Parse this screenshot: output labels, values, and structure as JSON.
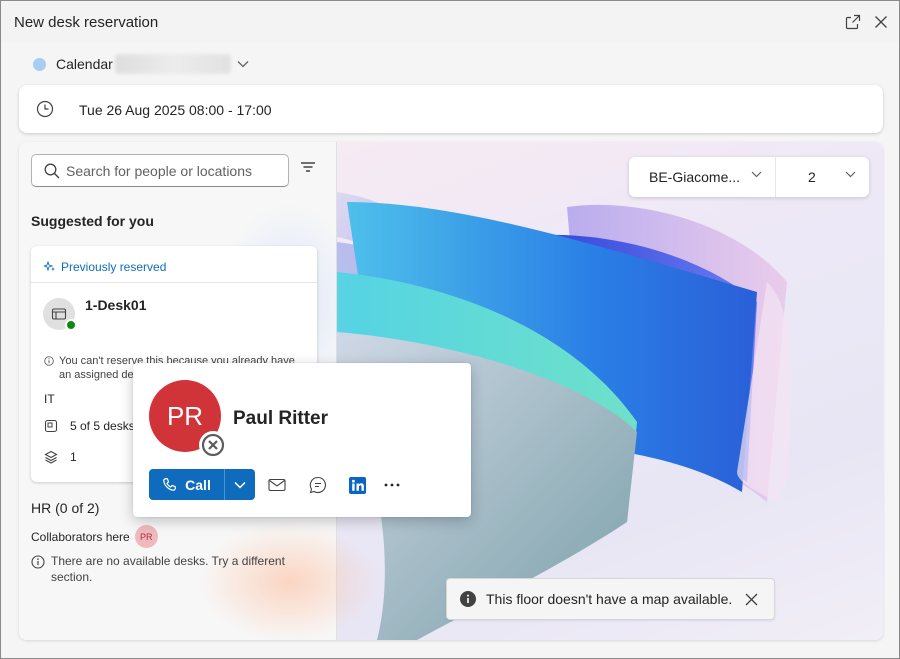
{
  "window": {
    "title": "New desk reservation"
  },
  "calendar": {
    "label": "Calendar"
  },
  "reservation_time": {
    "text": "Tue 26 Aug 2025 08:00 - 17:00"
  },
  "search": {
    "placeholder": "Search for people or locations"
  },
  "suggested": {
    "heading": "Suggested for you",
    "card": {
      "tag": "Previously reserved",
      "desk_name": "1-Desk01",
      "note": "You can't reserve this because you already have an assigned desk (2-",
      "department": "IT",
      "desks_text": "5 of 5 desks",
      "floor": "1"
    }
  },
  "hr_section": {
    "title": "HR (0 of 2)",
    "collaborators_label": "Collaborators here",
    "collaborator_initials": "PR",
    "note": "There are no available desks. Try a different section."
  },
  "location": {
    "building": "BE-Giacome...",
    "floor": "2"
  },
  "toast": {
    "message": "This floor doesn't have a map available."
  },
  "contact_card": {
    "initials": "PR",
    "name": "Paul Ritter",
    "call_label": "Call",
    "actions": [
      "mail-icon",
      "chat-icon",
      "linkedin-icon",
      "more-icon"
    ]
  },
  "colors": {
    "accent": "#0f6cbd",
    "avatar_red": "#d13438",
    "available_green": "#0e8a0e",
    "calendar_dot": "#a9cdf2"
  }
}
